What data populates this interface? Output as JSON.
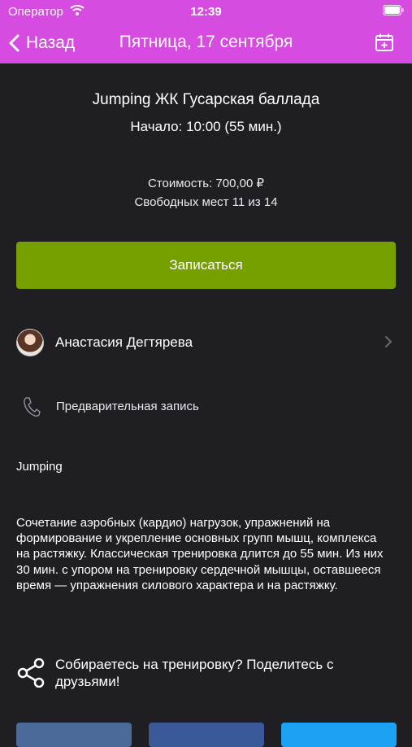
{
  "status_bar": {
    "carrier": "Оператор",
    "time": "12:39"
  },
  "nav": {
    "back_label": "Назад",
    "title": "Пятница, 17 сентября"
  },
  "class_info": {
    "title": "Jumping ЖК Гусарская баллада",
    "start": "Начало: 10:00 (55 мин.)",
    "price": "Стоимость: 700,00 ₽",
    "seats": "Свободных мест 11 из 14"
  },
  "signup_button": "Записаться",
  "trainer": {
    "name": "Анастасия Дегтярева"
  },
  "booking": {
    "label": "Предварительная запись"
  },
  "category": "Jumping",
  "description": "Сочетание аэробных (кардио) нагрузок, упражнений на формирование и укрепление основных групп мышц, комплекса на растяжку. Классическая тренировка длится до 55 мин. Из них 30 мин. с упором на тренировку сердечной мышцы, оставшееся время — упражнения силового характера и на растяжку.",
  "share": {
    "text": "Собираетесь на тренировку? Поделитесь с друзьями!"
  },
  "colors": {
    "header": "#d64be0",
    "background": "#1f1f23",
    "accent_button": "#76a000"
  },
  "icons": [
    "wifi-icon",
    "battery-icon",
    "back-chevron-icon",
    "calendar-icon",
    "chevron-right-icon",
    "phone-icon",
    "share-icon"
  ]
}
